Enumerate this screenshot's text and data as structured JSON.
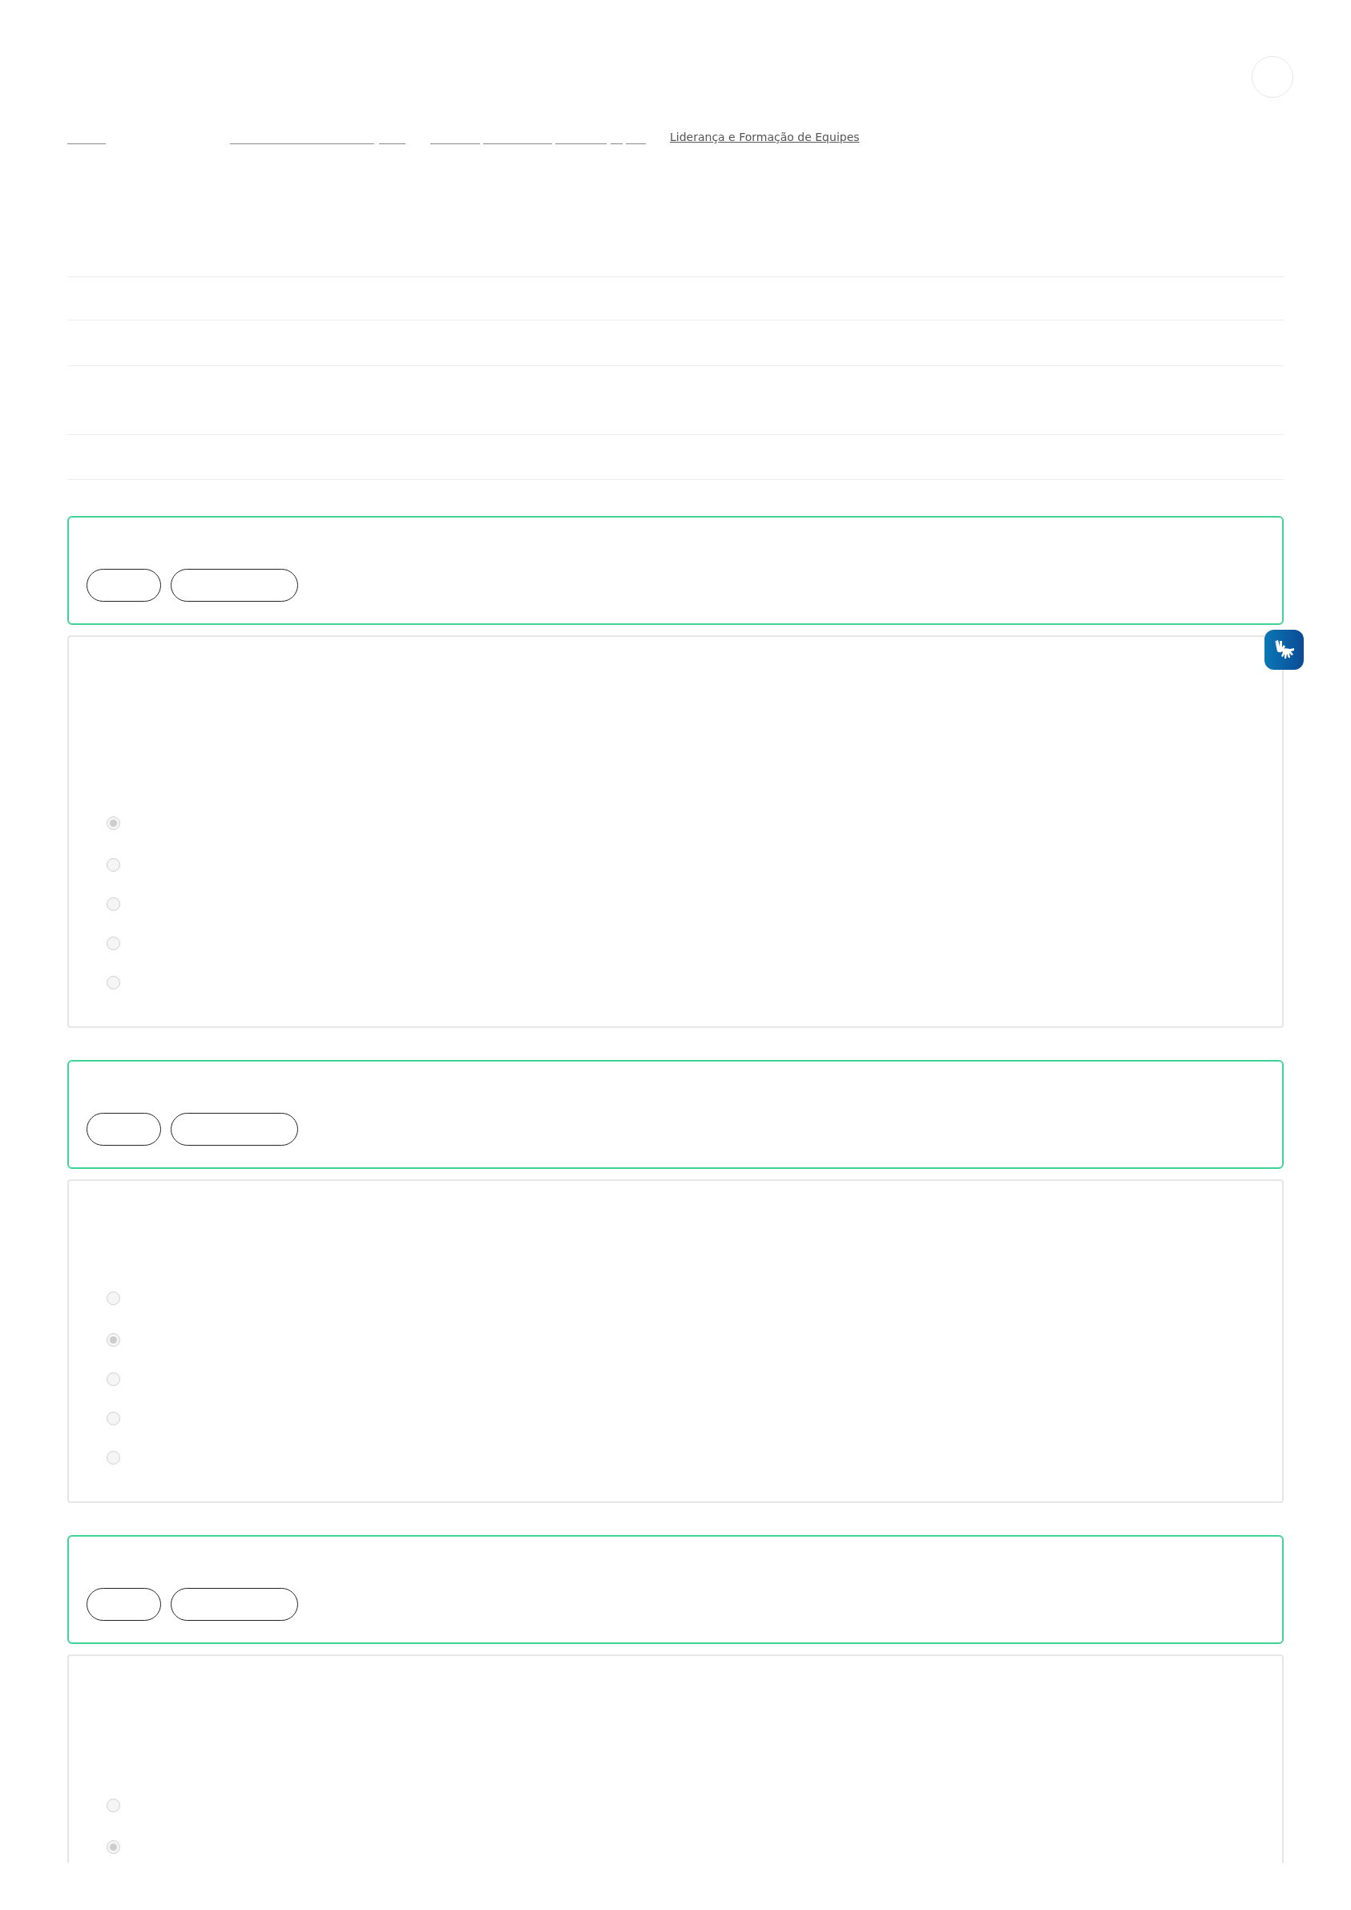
{
  "breadcrumb": {
    "current": "Liderança e Formação de Equipes"
  },
  "questions": [
    {
      "options": [
        {
          "selected": true
        },
        {
          "selected": false
        },
        {
          "selected": false
        },
        {
          "selected": false
        },
        {
          "selected": false
        }
      ]
    },
    {
      "options": [
        {
          "selected": false
        },
        {
          "selected": true
        },
        {
          "selected": false
        },
        {
          "selected": false
        },
        {
          "selected": false
        }
      ]
    },
    {
      "options": [
        {
          "selected": false
        },
        {
          "selected": true
        }
      ]
    }
  ]
}
